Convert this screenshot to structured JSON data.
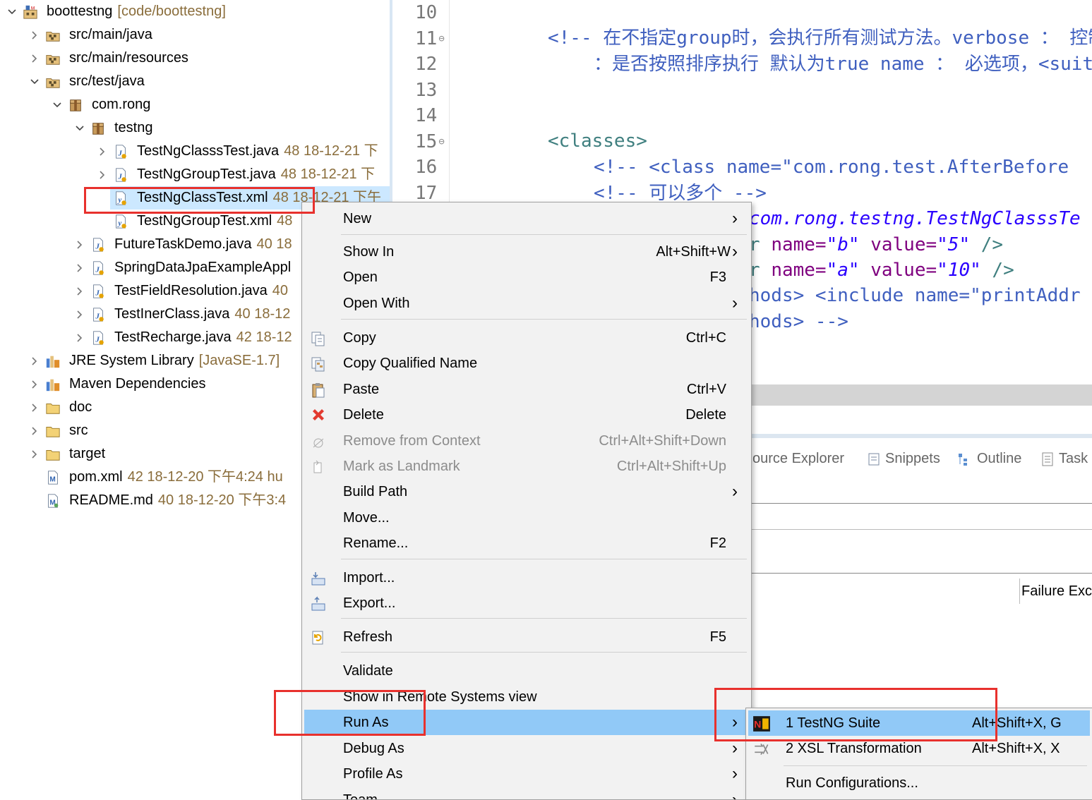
{
  "tree": {
    "rows": [
      {
        "expanded": true,
        "icon": "maven-project-icon",
        "label": "boottestng",
        "decoration": "[code/boottestng]"
      },
      {
        "expanded": false,
        "icon": "source-folder-icon",
        "label": "src/main/java",
        "decoration": ""
      },
      {
        "expanded": false,
        "icon": "source-folder-icon",
        "label": "src/main/resources",
        "decoration": ""
      },
      {
        "expanded": true,
        "icon": "source-folder-icon",
        "label": "src/test/java",
        "decoration": ""
      },
      {
        "expanded": true,
        "icon": "package-icon",
        "label": "com.rong",
        "decoration": ""
      },
      {
        "expanded": true,
        "icon": "package-icon",
        "label": "testng",
        "decoration": ""
      },
      {
        "expanded": false,
        "icon": "java-file-icon",
        "label": "TestNgClasssTest.java",
        "decoration": "48  18-12-21 下"
      },
      {
        "expanded": false,
        "icon": "java-file-icon",
        "label": "TestNgGroupTest.java",
        "decoration": "48  18-12-21 下"
      },
      {
        "expanded": null,
        "icon": "xml-file-icon",
        "label": "TestNgClassTest.xml",
        "decoration": "48  18-12-21 下午"
      },
      {
        "expanded": null,
        "icon": "xml-file-icon",
        "label": "TestNgGroupTest.xml",
        "decoration": "48"
      },
      {
        "expanded": false,
        "icon": "java-file-icon",
        "label": "FutureTaskDemo.java",
        "decoration": "40  18"
      },
      {
        "expanded": false,
        "icon": "java-file-icon",
        "label": "SpringDataJpaExampleAppl",
        "decoration": ""
      },
      {
        "expanded": false,
        "icon": "java-file-icon",
        "label": "TestFieldResolution.java",
        "decoration": "40"
      },
      {
        "expanded": false,
        "icon": "java-file-icon",
        "label": "TestInerClass.java",
        "decoration": "40  18-12"
      },
      {
        "expanded": false,
        "icon": "java-file-icon",
        "label": "TestRecharge.java",
        "decoration": "42  18-12"
      },
      {
        "expanded": false,
        "icon": "library-icon",
        "label": "JRE System Library",
        "decoration": "[JavaSE-1.7]"
      },
      {
        "expanded": false,
        "icon": "library-icon",
        "label": "Maven Dependencies",
        "decoration": ""
      },
      {
        "expanded": false,
        "icon": "folder-icon",
        "label": "doc",
        "decoration": ""
      },
      {
        "expanded": false,
        "icon": "folder-icon",
        "label": "src",
        "decoration": ""
      },
      {
        "expanded": false,
        "icon": "folder-icon",
        "label": "target",
        "decoration": ""
      },
      {
        "expanded": null,
        "icon": "maven-pom-icon",
        "label": "pom.xml",
        "decoration": "42  18-12-20 下午4:24  hu"
      },
      {
        "expanded": null,
        "icon": "markdown-file-icon",
        "label": "README.md",
        "decoration": "40  18-12-20 下午3:4"
      }
    ]
  },
  "editor": {
    "line_numbers": [
      "10",
      "11",
      "12",
      "13",
      "14",
      "15",
      "16",
      "17"
    ],
    "code": {
      "l11": "<!-- 在不指定group时，会执行所有测试方法。verbose ： 控制",
      "l12": "：是否按照排序执行 默认为true name ： 必选项，<suite",
      "l15": "<classes>",
      "l16": "<!-- <class name=\"com.rong.test.AfterBefore",
      "l17": "<!-- 可以多个 -->",
      "l18": "com.rong.testng.TestNgClasssTe",
      "l19a": "name=",
      "l19b": "\"b\"",
      "l19c": " value=",
      "l19d": "\"5\"",
      "l19e": " />",
      "l20a": "name=",
      "l20b": "\"a\"",
      "l20c": " value=",
      "l20d": "\"10\"",
      "l20e": " />",
      "l21": "hods> <include name=\"printAddr",
      "l22": "hods> -->"
    }
  },
  "bottom_panel": {
    "tabs": [
      {
        "label": "ource Explorer",
        "icon": ""
      },
      {
        "label": "Snippets",
        "icon": "snippets-icon"
      },
      {
        "label": "Outline",
        "icon": "outline-icon"
      },
      {
        "label": "Task",
        "icon": "tasks-icon"
      }
    ],
    "failure_header": "Failure Exc"
  },
  "context_menu": {
    "items": [
      {
        "label": "New",
        "shortcut": "",
        "submenu": true,
        "icon": "",
        "disabled": false
      },
      {
        "label": "Show In",
        "shortcut": "Alt+Shift+W",
        "submenu": true,
        "icon": "",
        "disabled": false
      },
      {
        "label": "Open",
        "shortcut": "F3",
        "submenu": false,
        "icon": "",
        "disabled": false
      },
      {
        "label": "Open With",
        "shortcut": "",
        "submenu": true,
        "icon": "",
        "disabled": false
      },
      {
        "label": "Copy",
        "shortcut": "Ctrl+C",
        "submenu": false,
        "icon": "copy-icon",
        "disabled": false
      },
      {
        "label": "Copy Qualified Name",
        "shortcut": "",
        "submenu": false,
        "icon": "copy-qualified-name-icon",
        "disabled": false
      },
      {
        "label": "Paste",
        "shortcut": "Ctrl+V",
        "submenu": false,
        "icon": "paste-icon",
        "disabled": false
      },
      {
        "label": "Delete",
        "shortcut": "Delete",
        "submenu": false,
        "icon": "delete-icon",
        "disabled": false
      },
      {
        "label": "Remove from Context",
        "shortcut": "Ctrl+Alt+Shift+Down",
        "submenu": false,
        "icon": "remove-context-icon",
        "disabled": true
      },
      {
        "label": "Mark as Landmark",
        "shortcut": "Ctrl+Alt+Shift+Up",
        "submenu": false,
        "icon": "landmark-icon",
        "disabled": true
      },
      {
        "label": "Build Path",
        "shortcut": "",
        "submenu": true,
        "icon": "",
        "disabled": false
      },
      {
        "label": "Move...",
        "shortcut": "",
        "submenu": false,
        "icon": "",
        "disabled": false
      },
      {
        "label": "Rename...",
        "shortcut": "F2",
        "submenu": false,
        "icon": "",
        "disabled": false
      },
      {
        "label": "Import...",
        "shortcut": "",
        "submenu": false,
        "icon": "import-icon",
        "disabled": false
      },
      {
        "label": "Export...",
        "shortcut": "",
        "submenu": false,
        "icon": "export-icon",
        "disabled": false
      },
      {
        "label": "Refresh",
        "shortcut": "F5",
        "submenu": false,
        "icon": "refresh-icon",
        "disabled": false
      },
      {
        "label": "Validate",
        "shortcut": "",
        "submenu": false,
        "icon": "",
        "disabled": false
      },
      {
        "label": "Show in Remote Systems view",
        "shortcut": "",
        "submenu": false,
        "icon": "",
        "disabled": false
      },
      {
        "label": "Run As",
        "shortcut": "",
        "submenu": true,
        "icon": "",
        "disabled": false,
        "highlighted": true
      },
      {
        "label": "Debug As",
        "shortcut": "",
        "submenu": true,
        "icon": "",
        "disabled": false
      },
      {
        "label": "Profile As",
        "shortcut": "",
        "submenu": true,
        "icon": "",
        "disabled": false
      },
      {
        "label": "Team",
        "shortcut": "",
        "submenu": true,
        "icon": "",
        "disabled": false
      }
    ]
  },
  "run_as_submenu": {
    "items": [
      {
        "label": "1 TestNG Suite",
        "shortcut": "Alt+Shift+X, G",
        "icon": "testng-icon",
        "highlighted": true
      },
      {
        "label": "2 XSL Transformation",
        "shortcut": "Alt+Shift+X, X",
        "icon": "xsl-transform-icon",
        "highlighted": false
      },
      {
        "label": "Run Configurations...",
        "shortcut": "",
        "icon": "",
        "highlighted": false
      }
    ]
  },
  "colors": {
    "menu_highlight": "#91c9f7",
    "annotation_red": "#e8312d",
    "tree_selection": "#cce8ff",
    "comment": "#3f5fbf",
    "xml_tag": "#3f7f7f"
  }
}
